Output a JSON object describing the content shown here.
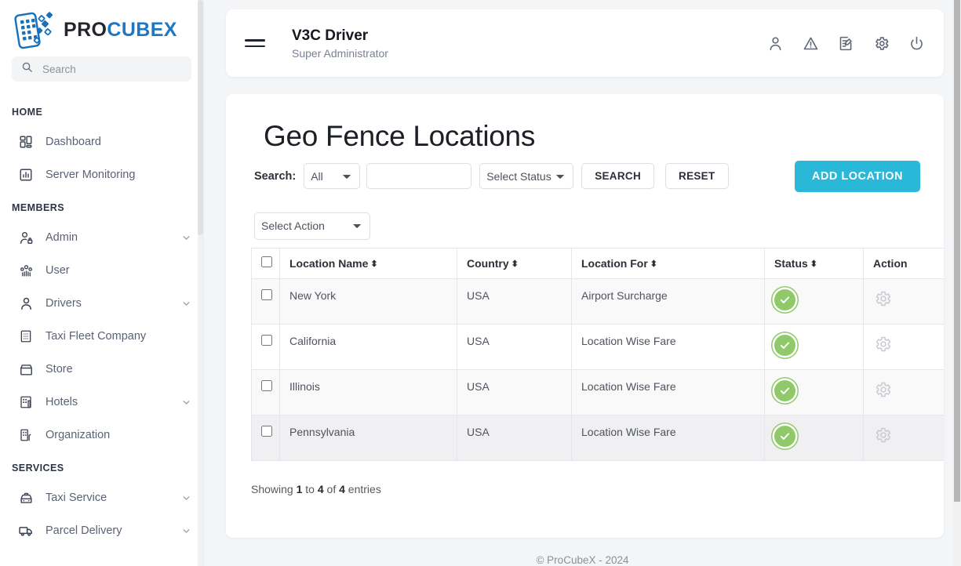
{
  "brand": {
    "name_dark": "PRO",
    "name_accent": "CUBEX",
    "accent_color": "#1f77c4"
  },
  "search": {
    "placeholder": "Search",
    "value": ""
  },
  "sidebar": {
    "sections": [
      {
        "label": "HOME",
        "items": [
          {
            "label": "Dashboard",
            "icon": "dashboard-icon",
            "expandable": false
          },
          {
            "label": "Server Monitoring",
            "icon": "chart-monitor-icon",
            "expandable": false
          }
        ]
      },
      {
        "label": "MEMBERS",
        "items": [
          {
            "label": "Admin",
            "icon": "user-lock-icon",
            "expandable": true
          },
          {
            "label": "User",
            "icon": "users-group-icon",
            "expandable": false
          },
          {
            "label": "Drivers",
            "icon": "person-icon",
            "expandable": true
          },
          {
            "label": "Taxi Fleet Company",
            "icon": "building-grid-icon",
            "expandable": false
          },
          {
            "label": "Store",
            "icon": "store-icon",
            "expandable": false
          },
          {
            "label": "Hotels",
            "icon": "hotel-icon",
            "expandable": true
          },
          {
            "label": "Organization",
            "icon": "organization-icon",
            "expandable": false
          }
        ]
      },
      {
        "label": "SERVICES",
        "items": [
          {
            "label": "Taxi Service",
            "icon": "taxi-icon",
            "expandable": true
          },
          {
            "label": "Parcel Delivery",
            "icon": "delivery-truck-icon",
            "expandable": true
          }
        ]
      }
    ]
  },
  "topbar": {
    "title": "V3C Driver",
    "subtitle": "Super Administrator",
    "icons": [
      "profile-icon",
      "alert-triangle-icon",
      "edit-document-icon",
      "gear-icon",
      "power-icon"
    ]
  },
  "page": {
    "title": "Geo Fence Locations",
    "search_label": "Search:",
    "scope_select": {
      "value": "All",
      "options": [
        "All"
      ]
    },
    "keyword_input": {
      "value": "",
      "placeholder": ""
    },
    "status_select": {
      "value": "Select Status",
      "options": [
        "Select Status"
      ]
    },
    "search_button": "SEARCH",
    "reset_button": "RESET",
    "add_button": "ADD LOCATION",
    "add_button_color": "#2ab8d9",
    "action_select": {
      "value": "Select Action",
      "options": [
        "Select Action"
      ]
    }
  },
  "table": {
    "columns": [
      {
        "key": "check",
        "label": "",
        "sortable": false
      },
      {
        "key": "name",
        "label": "Location Name",
        "sortable": true
      },
      {
        "key": "country",
        "label": "Country",
        "sortable": true
      },
      {
        "key": "for",
        "label": "Location For",
        "sortable": true
      },
      {
        "key": "status",
        "label": "Status",
        "sortable": true
      },
      {
        "key": "action",
        "label": "Action",
        "sortable": false
      }
    ],
    "rows": [
      {
        "name": "New York",
        "country": "USA",
        "for": "Airport Surcharge",
        "status": "active",
        "action": "gear-icon"
      },
      {
        "name": "California",
        "country": "USA",
        "for": "Location Wise Fare",
        "status": "active",
        "action": "gear-icon"
      },
      {
        "name": "Illinois",
        "country": "USA",
        "for": "Location Wise Fare",
        "status": "active",
        "action": "gear-icon"
      },
      {
        "name": "Pennsylvania",
        "country": "USA",
        "for": "Location Wise Fare",
        "status": "active",
        "action": "gear-icon"
      }
    ],
    "status_color": "#90c96a"
  },
  "showing": {
    "prefix": "Showing ",
    "from": "1",
    "mid1": " to ",
    "to": "4",
    "mid2": " of ",
    "total": "4",
    "suffix": " entries"
  },
  "footer": {
    "text": "© ProCubeX - 2024"
  }
}
